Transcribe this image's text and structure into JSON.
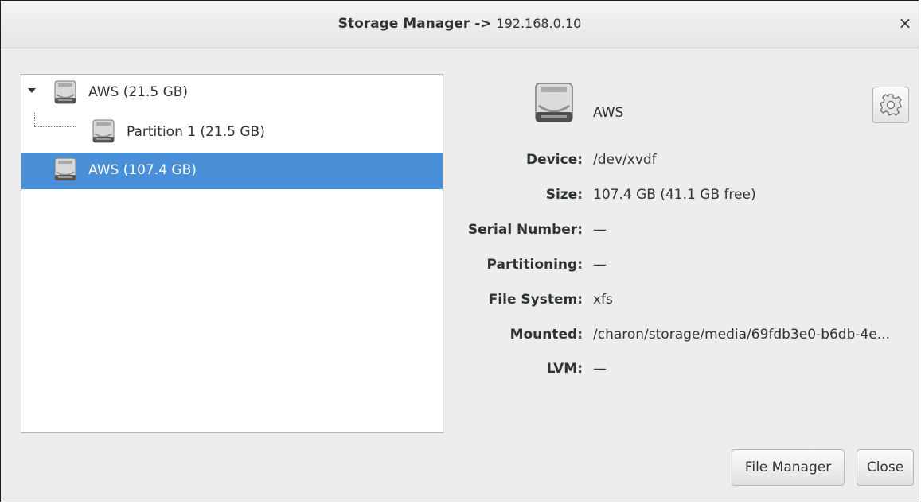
{
  "window": {
    "title": "Storage Manager ->",
    "host": "192.168.0.10",
    "close_glyph": "×",
    "close_icon": "close-icon"
  },
  "tree": {
    "rows": [
      {
        "label": "AWS (21.5 GB)",
        "icon": "hard-disk-icon",
        "expanded": true,
        "selected": false
      },
      {
        "label": "Partition 1 (21.5 GB)",
        "icon": "hard-disk-icon",
        "selected": false
      },
      {
        "label": "AWS (107.4 GB)",
        "icon": "hard-disk-icon",
        "selected": true
      }
    ],
    "selection_color": "#4a90d9"
  },
  "details": {
    "name": "AWS",
    "settings_icon": "gear-icon",
    "properties": [
      {
        "label": "Device:",
        "value": "/dev/xvdf"
      },
      {
        "label": "Size:",
        "value": "107.4 GB (41.1 GB free)"
      },
      {
        "label": "Serial Number:",
        "value": "—"
      },
      {
        "label": "Partitioning:",
        "value": "—"
      },
      {
        "label": "File System:",
        "value": "xfs"
      },
      {
        "label": "Mounted:",
        "value": "/charon/storage/media/69fdb3e0-b6db-4e..."
      },
      {
        "label": "LVM:",
        "value": "—"
      }
    ]
  },
  "buttons": {
    "file_manager": "File Manager",
    "close": "Close"
  }
}
